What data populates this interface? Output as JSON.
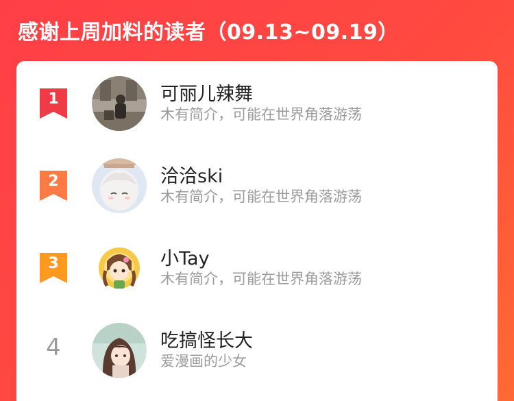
{
  "header": {
    "title": "感谢上周加料的读者（09.13~09.19）"
  },
  "colors": {
    "background": "#ff4444",
    "rank1": "#f03b47",
    "rank2": "#ff7a45",
    "rank3": "#ff9a1e",
    "rank_plain": "#9a9a9a"
  },
  "readers": [
    {
      "rank": "1",
      "name": "可丽儿辣舞",
      "description": "木有简介，可能在世界角落游荡",
      "avatar": "vintage-photo-avatar"
    },
    {
      "rank": "2",
      "name": "洽洽ski",
      "description": "木有简介，可能在世界角落游荡",
      "avatar": "anime-boy-avatar"
    },
    {
      "rank": "3",
      "name": "小Tay",
      "description": "木有简介，可能在世界角落游荡",
      "avatar": "anime-girl-braids-avatar"
    },
    {
      "rank": "4",
      "name": "吃搞怪长大",
      "description": "爱漫画的少女",
      "avatar": "anime-girl-brown-hair-avatar"
    }
  ]
}
